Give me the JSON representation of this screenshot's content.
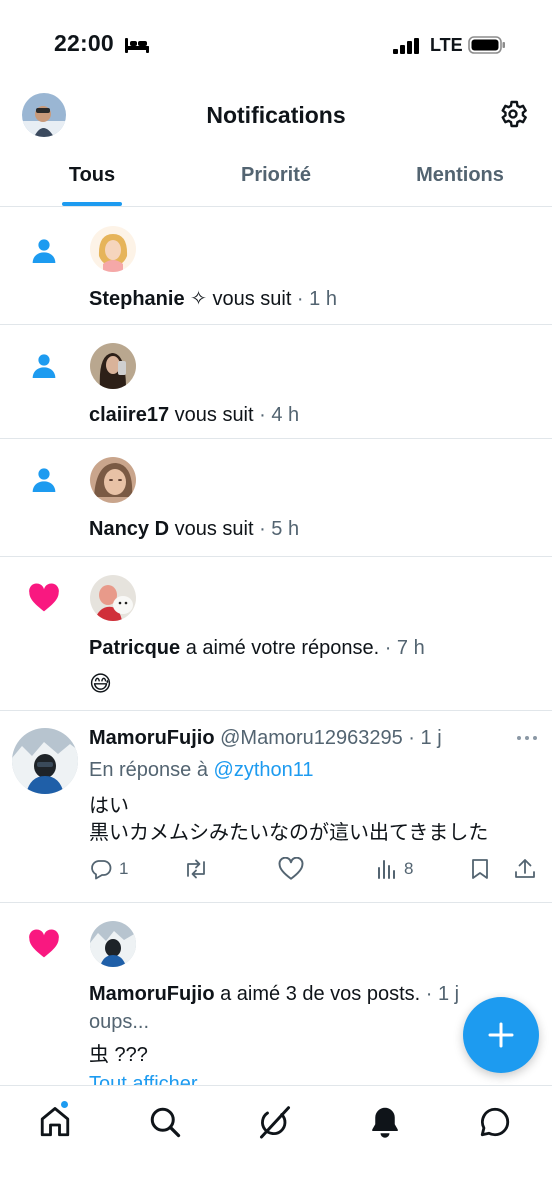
{
  "status_bar": {
    "time": "22:00",
    "network": "LTE"
  },
  "header": {
    "title": "Notifications"
  },
  "tabs": [
    {
      "label": "Tous",
      "active": true
    },
    {
      "label": "Priorité",
      "active": false
    },
    {
      "label": "Mentions",
      "active": false
    }
  ],
  "notifications": [
    {
      "type": "follow",
      "icon": "person-icon",
      "actor": "Stephanie ✧",
      "action": " vous suit",
      "time": " · 1 h"
    },
    {
      "type": "follow",
      "icon": "person-icon",
      "actor": "claiire17",
      "action": " vous suit",
      "time": " · 4 h"
    },
    {
      "type": "follow",
      "icon": "person-icon",
      "actor": "Nancy D",
      "action": " vous suit",
      "time": " · 5 h"
    },
    {
      "type": "like",
      "icon": "heart-icon",
      "actor": "Patricque",
      "action": " a aimé votre réponse.",
      "time": " · 7 h",
      "preview": "😅"
    }
  ],
  "post": {
    "name": "MamoruFujio",
    "handle": " @Mamoru12963295",
    "time": " · 1 j",
    "reply_prefix": "En réponse à ",
    "reply_to": "@zython11",
    "text_line1": "はい",
    "text_line2": "黒いカメムシみたいなのが這い出てきました",
    "replies": "1",
    "views": "8"
  },
  "like_group": {
    "actor": "MamoruFujio",
    "action": " a aimé 3 de vos posts.",
    "time": " · 1 j",
    "preview1": "oups...",
    "preview2": "虫 ???",
    "show_all": "Tout afficher"
  },
  "colors": {
    "accent": "#1d9bf0",
    "like": "#f91880",
    "text": "#0f1419",
    "muted": "#536471"
  }
}
